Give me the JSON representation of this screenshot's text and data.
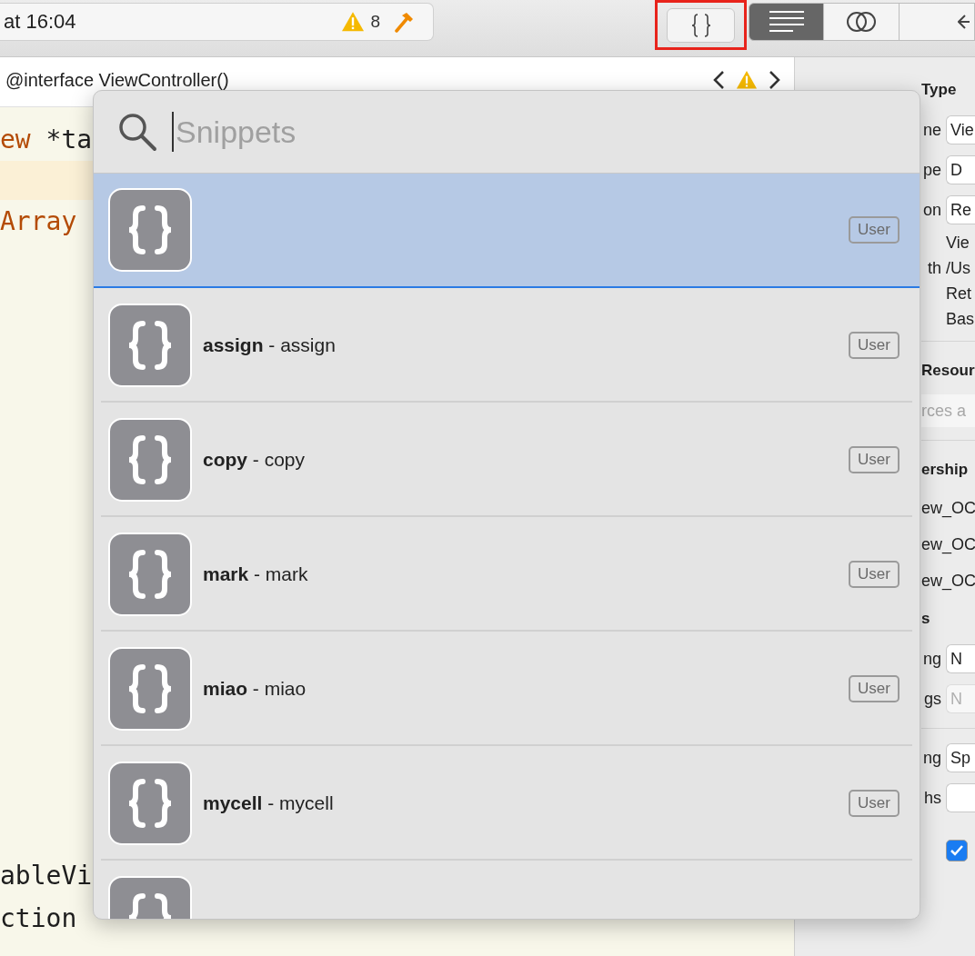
{
  "toolbar": {
    "status": "at 16:04",
    "warning_count": "8",
    "snippets_button": {
      "highlighted": true
    },
    "segments": [
      {
        "kind": "lines",
        "selected": true
      },
      {
        "kind": "circles",
        "selected": false
      },
      {
        "kind": "arrow",
        "selected": false
      }
    ]
  },
  "jump_bar": {
    "title": "@interface ViewController()"
  },
  "editor": {
    "lines": [
      {
        "highlighted": false,
        "tokens": [
          {
            "kind": "keyword",
            "text": "ew"
          },
          {
            "kind": "plain",
            "text": " *ta"
          }
        ]
      },
      {
        "highlighted": true
      },
      {
        "highlighted": false,
        "tokens": [
          {
            "kind": "keyword",
            "text": "Array"
          }
        ]
      }
    ],
    "bottom_lines": [
      {
        "highlighted": false,
        "tokens": [
          {
            "kind": "plain",
            "text": "ableVi"
          }
        ]
      },
      {
        "highlighted": false,
        "tokens": [
          {
            "kind": "plain",
            "text": "ction"
          }
        ]
      }
    ]
  },
  "inspector": {
    "rows": [
      {
        "kind": "header",
        "text": "Type"
      },
      {
        "kind": "field",
        "label": "ne",
        "value": "Vie",
        "disabled": false
      },
      {
        "kind": "field",
        "label": "pe",
        "value": "D",
        "disabled": false
      },
      {
        "kind": "field",
        "label": "on",
        "value": "Re",
        "disabled": false
      },
      {
        "kind": "text",
        "value": "Vie"
      },
      {
        "kind": "text",
        "label": "th",
        "value": "/Us"
      },
      {
        "kind": "text",
        "value": "Ret"
      },
      {
        "kind": "text",
        "value": "Bas"
      },
      {
        "kind": "divider"
      },
      {
        "kind": "header",
        "text": "Resour"
      },
      {
        "kind": "search",
        "placeholder": "rces a"
      },
      {
        "kind": "divider"
      },
      {
        "kind": "header",
        "text": "ership"
      },
      {
        "kind": "plain",
        "text": "ew_OC"
      },
      {
        "kind": "plain",
        "text": "ew_OC"
      },
      {
        "kind": "plain",
        "text": "ew_OC"
      },
      {
        "kind": "header",
        "text": "s"
      },
      {
        "kind": "field",
        "label": "ng",
        "value": "N",
        "disabled": false
      },
      {
        "kind": "field",
        "label": "gs",
        "value": "N",
        "disabled": true
      },
      {
        "kind": "divider"
      },
      {
        "kind": "field",
        "label": "ng",
        "value": "Sp",
        "disabled": false
      },
      {
        "kind": "field",
        "label": "hs",
        "disabled": false
      },
      {
        "kind": "checkbox",
        "checked": true
      }
    ]
  },
  "popup": {
    "search": {
      "placeholder": "Snippets"
    },
    "snippets": [
      {
        "badge": "User",
        "selected": true
      },
      {
        "text": "**assign** - assign",
        "badge": "User",
        "selected": false
      },
      {
        "text": "**copy** - copy",
        "badge": "User",
        "selected": false
      },
      {
        "text": "**mark** - mark",
        "badge": "User",
        "selected": false
      },
      {
        "text": "**miao** - miao",
        "badge": "User",
        "selected": false
      },
      {
        "text": "**mycell** - mycell",
        "badge": "User",
        "selected": false
      },
      {
        "selected": false
      }
    ]
  }
}
